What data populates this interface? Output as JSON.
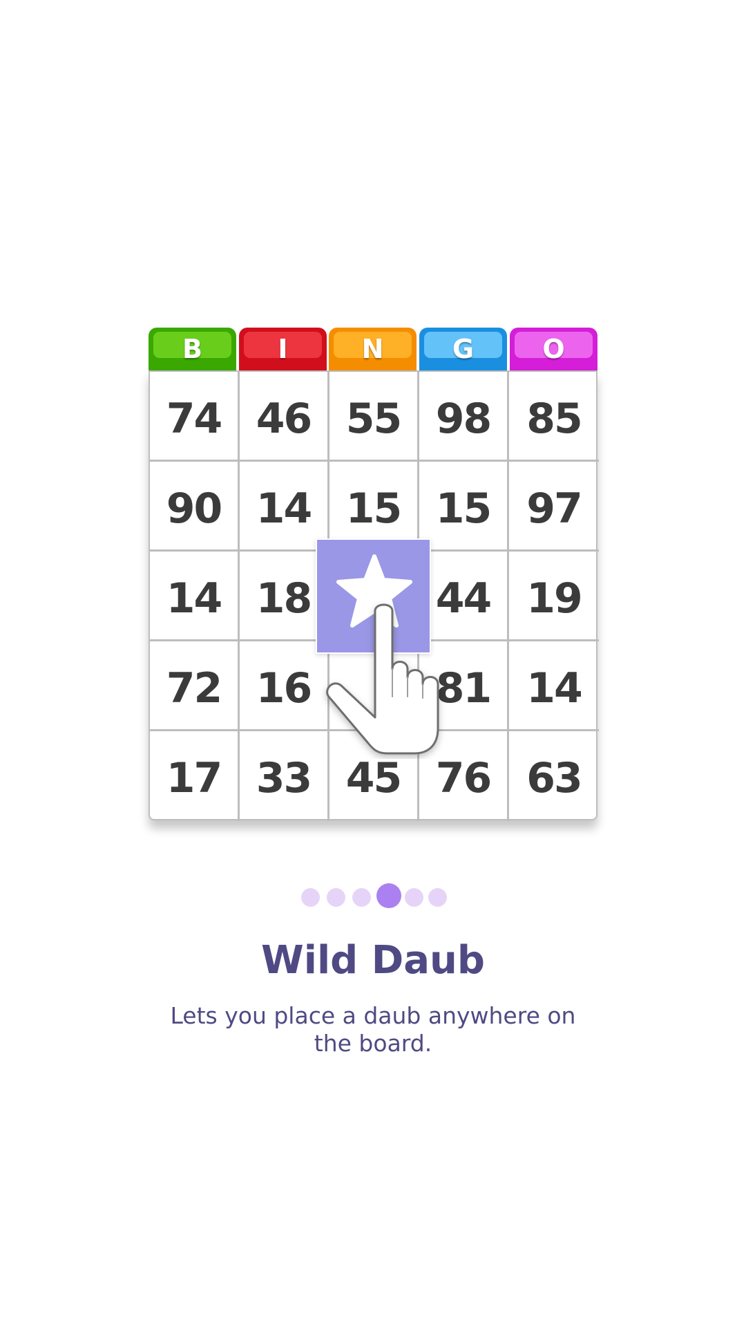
{
  "card": {
    "headers": [
      {
        "letter": "B",
        "color": "#3aa800",
        "gloss": "#6fd11e"
      },
      {
        "letter": "I",
        "color": "#d10f1c",
        "gloss": "#f03a45"
      },
      {
        "letter": "N",
        "color": "#f58d00",
        "gloss": "#ffb42a"
      },
      {
        "letter": "G",
        "color": "#1a8fe0",
        "gloss": "#6cc8fb"
      },
      {
        "letter": "O",
        "color": "#d41ed8",
        "gloss": "#ee6cf1"
      }
    ],
    "rows": [
      [
        "74",
        "46",
        "55",
        "98",
        "85"
      ],
      [
        "90",
        "14",
        "15",
        "15",
        "97"
      ],
      [
        "14",
        "18",
        "",
        "44",
        "19"
      ],
      [
        "72",
        "16",
        "",
        "81",
        "14"
      ],
      [
        "17",
        "33",
        "45",
        "76",
        "63"
      ]
    ],
    "wild_tile": {
      "icon": "star-icon",
      "color": "#9a97e6"
    }
  },
  "pager": {
    "count": 6,
    "active_index": 3,
    "active_color": "#ab80f1",
    "inactive_color": "#e6d4f8"
  },
  "title": "Wild Daub",
  "description": "Lets  you place a daub anywhere on the board."
}
